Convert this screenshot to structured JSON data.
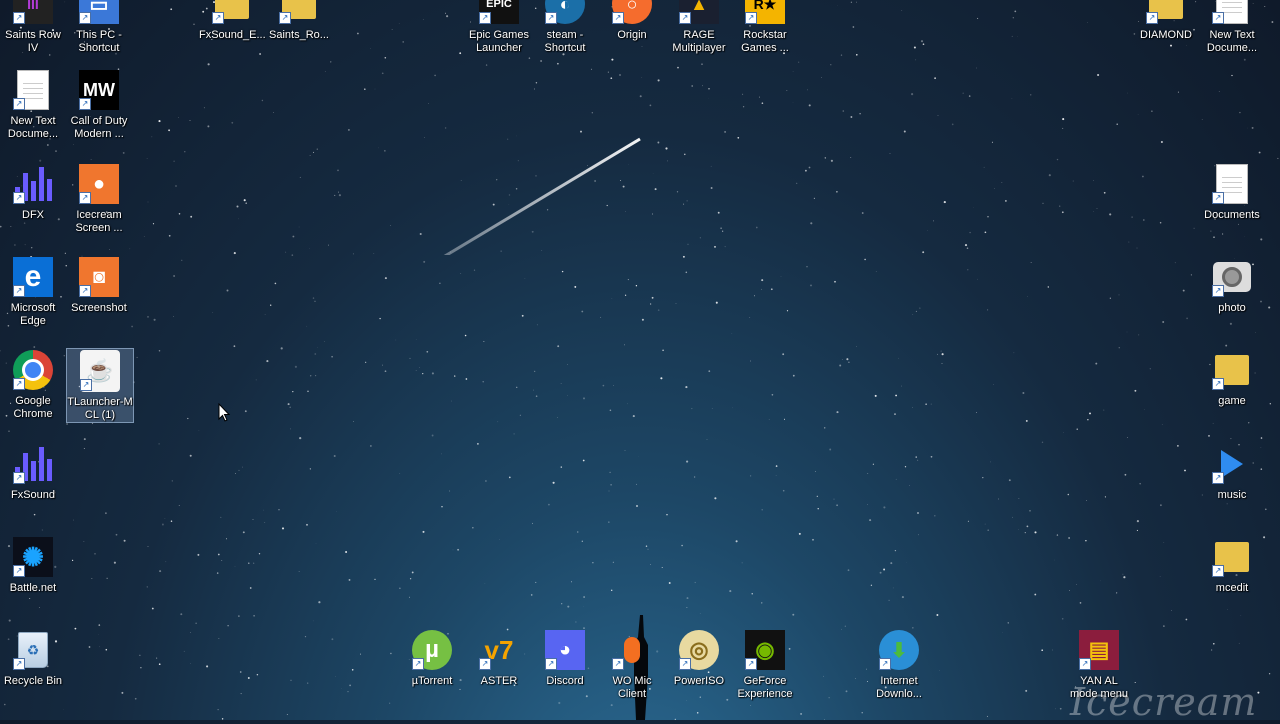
{
  "desktop": {
    "left_column_1": [
      {
        "label": "Saints Row IV",
        "icon": "saints-row-icon"
      },
      {
        "label": "New Text\nDocume...",
        "icon": "text-document-icon"
      },
      {
        "label": "DFX",
        "icon": "dfx-icon"
      },
      {
        "label": "Microsoft\nEdge",
        "icon": "edge-icon"
      },
      {
        "label": "Google\nChrome",
        "icon": "chrome-icon"
      },
      {
        "label": "FxSound",
        "icon": "fxsound-icon"
      },
      {
        "label": "Battle.net",
        "icon": "battlenet-icon"
      },
      {
        "label": "Recycle Bin",
        "icon": "recycle-bin-icon"
      }
    ],
    "left_column_2": [
      {
        "label": "This PC -\nShortcut",
        "icon": "this-pc-icon"
      },
      {
        "label": "Call of Duty\nModern ...",
        "icon": "call-of-duty-icon"
      },
      {
        "label": "Icecream\nScreen ...",
        "icon": "icecream-icon"
      },
      {
        "label": "Screenshot",
        "icon": "screenshot-icon"
      },
      {
        "label": "TLauncher-M\nCL (1)",
        "icon": "java-icon"
      }
    ],
    "top_row": [
      {
        "label": "FxSound_E...",
        "icon": "folder-icon"
      },
      {
        "label": "Saints_Ro...",
        "icon": "folder-icon"
      },
      {
        "label": "Epic Games\nLauncher",
        "icon": "epic-games-icon"
      },
      {
        "label": "steam -\nShortcut",
        "icon": "steam-icon"
      },
      {
        "label": "Origin",
        "icon": "origin-icon"
      },
      {
        "label": "RAGE\nMultiplayer",
        "icon": "rage-icon"
      },
      {
        "label": "Rockstar\nGames ...",
        "icon": "rockstar-icon"
      }
    ],
    "right_column": [
      {
        "label": "DIAMOND",
        "icon": "folder-icon"
      },
      {
        "label": "New Text\nDocume...",
        "icon": "text-document-icon"
      },
      {
        "label": "Documents",
        "icon": "text-document-icon"
      },
      {
        "label": "photo",
        "icon": "camera-icon"
      },
      {
        "label": "game",
        "icon": "folder-icon"
      },
      {
        "label": "music",
        "icon": "play-icon"
      },
      {
        "label": "mcedit",
        "icon": "folder-icon"
      }
    ],
    "bottom_row": [
      {
        "label": "µTorrent",
        "icon": "utorrent-icon"
      },
      {
        "label": "ASTER",
        "icon": "aster-icon"
      },
      {
        "label": "Discord",
        "icon": "discord-icon"
      },
      {
        "label": "WO Mic\nClient",
        "icon": "microphone-icon"
      },
      {
        "label": "PowerISO",
        "icon": "poweriso-icon"
      },
      {
        "label": "GeForce\nExperience",
        "icon": "nvidia-icon"
      },
      {
        "label": "Internet\nDownlo...",
        "icon": "idm-icon"
      },
      {
        "label": "YAN AL\nmode menu",
        "icon": "winrar-icon"
      }
    ],
    "watermark": "Icecream",
    "selected_item": "TLauncher-M\nCL (1)",
    "colors": {
      "sky_top": "#0f1a2a",
      "sky_bottom": "#2c6f99",
      "selection": "#96b4dc"
    }
  }
}
